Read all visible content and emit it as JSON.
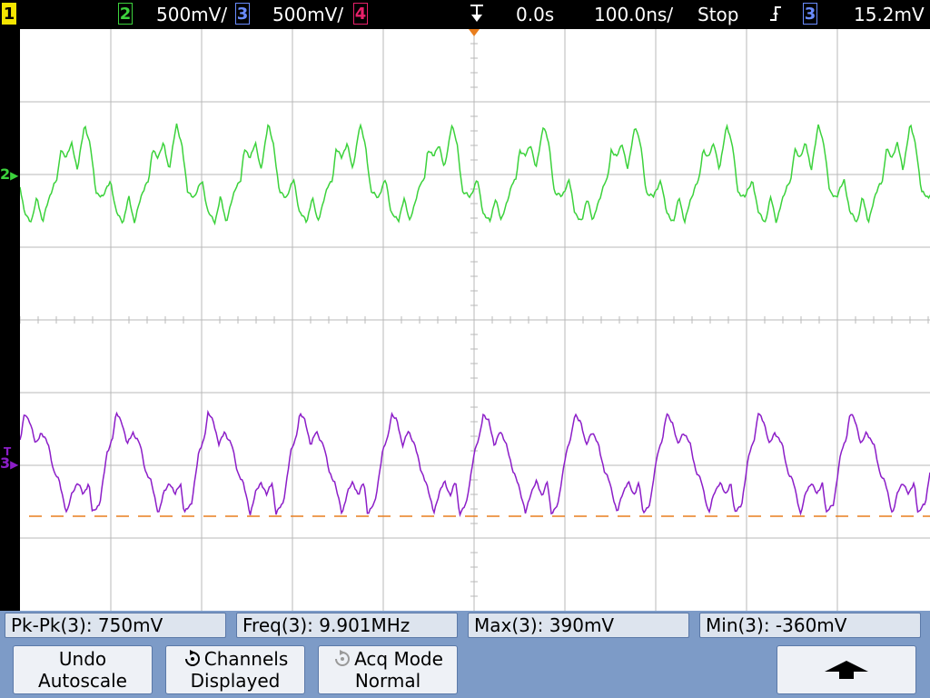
{
  "topbar": {
    "ch1": "1",
    "ch2": "2",
    "ch2_scale": "500mV/",
    "ch3": "3",
    "ch3_scale": "500mV/",
    "ch4": "4",
    "trigger_delay": "0.0s",
    "timebase": "100.0ns/",
    "run_state": "Stop",
    "trigger_source": "3",
    "trigger_level": "15.2mV"
  },
  "markers": {
    "ch2": "2",
    "ch3": "3"
  },
  "measurements": [
    {
      "label": "Pk-Pk(3): 750mV"
    },
    {
      "label": "Freq(3): 9.901MHz"
    },
    {
      "label": "Max(3): 390mV"
    },
    {
      "label": "Min(3): -360mV"
    }
  ],
  "softkeys": {
    "undo_line1": "Undo",
    "undo_line2": "Autoscale",
    "channels_line1": "Channels",
    "channels_line2": "Displayed",
    "acq_line1": "Acq Mode",
    "acq_line2": "Normal"
  },
  "colors": {
    "ch1": "#f5e500",
    "ch2": "#3cd23c",
    "ch3": "#8c1ec8",
    "ch4": "#e8206a",
    "trigger_level_line": "#e87e1e",
    "grid": "#b8b8b8"
  }
}
